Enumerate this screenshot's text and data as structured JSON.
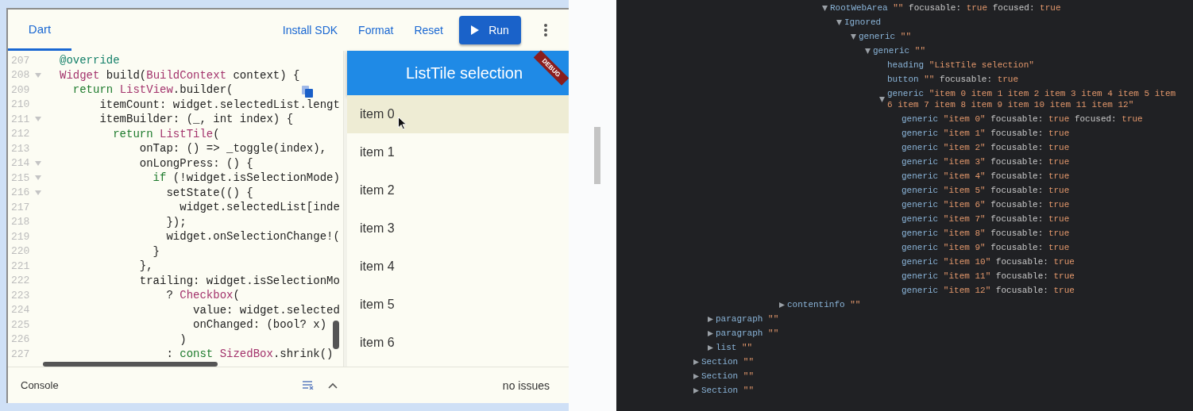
{
  "editor": {
    "tabs": [
      {
        "label": "Dart",
        "selected": true
      }
    ],
    "actions": [
      {
        "label": "Install SDK"
      },
      {
        "label": "Format"
      },
      {
        "label": "Reset"
      }
    ],
    "run_button": {
      "label": "Run"
    },
    "code": {
      "lines": [
        {
          "number": "207",
          "fold": false,
          "tokens": [
            {
              "kind": "annotation",
              "text": "@override"
            }
          ]
        },
        {
          "number": "208",
          "fold": true,
          "tokens": [
            {
              "kind": "type",
              "text": "Widget"
            },
            {
              "kind": "plain",
              "text": " build("
            },
            {
              "kind": "type",
              "text": "BuildContext"
            },
            {
              "kind": "plain",
              "text": " context) {"
            }
          ]
        },
        {
          "number": "209",
          "fold": false,
          "tokens": [
            {
              "kind": "keyword",
              "text": "  return "
            },
            {
              "kind": "type",
              "text": "ListView"
            },
            {
              "kind": "plain",
              "text": ".builder("
            }
          ]
        },
        {
          "number": "210",
          "fold": false,
          "tokens": [
            {
              "kind": "plain",
              "text": "      itemCount: widget.selectedList.lengt"
            }
          ]
        },
        {
          "number": "211",
          "fold": true,
          "tokens": [
            {
              "kind": "plain",
              "text": "      itemBuilder: (_, int index) {"
            }
          ]
        },
        {
          "number": "212",
          "fold": false,
          "tokens": [
            {
              "kind": "keyword",
              "text": "        return "
            },
            {
              "kind": "type",
              "text": "ListTile"
            },
            {
              "kind": "plain",
              "text": "("
            }
          ]
        },
        {
          "number": "213",
          "fold": false,
          "tokens": [
            {
              "kind": "plain",
              "text": "            onTap: () => _toggle(index),"
            }
          ]
        },
        {
          "number": "214",
          "fold": true,
          "tokens": [
            {
              "kind": "plain",
              "text": "            onLongPress: () {"
            }
          ]
        },
        {
          "number": "215",
          "fold": true,
          "tokens": [
            {
              "kind": "keyword",
              "text": "              if"
            },
            {
              "kind": "plain",
              "text": " (!widget.isSelectionMode)"
            }
          ]
        },
        {
          "number": "216",
          "fold": true,
          "tokens": [
            {
              "kind": "plain",
              "text": "                setState(() {"
            }
          ]
        },
        {
          "number": "217",
          "fold": false,
          "tokens": [
            {
              "kind": "plain",
              "text": "                  widget.selectedList[inde"
            }
          ]
        },
        {
          "number": "218",
          "fold": false,
          "tokens": [
            {
              "kind": "plain",
              "text": "                });"
            }
          ]
        },
        {
          "number": "219",
          "fold": false,
          "tokens": [
            {
              "kind": "plain",
              "text": "                widget.onSelectionChange!("
            }
          ]
        },
        {
          "number": "220",
          "fold": false,
          "tokens": [
            {
              "kind": "plain",
              "text": "              }"
            }
          ]
        },
        {
          "number": "221",
          "fold": false,
          "tokens": [
            {
              "kind": "plain",
              "text": "            },"
            }
          ]
        },
        {
          "number": "222",
          "fold": false,
          "tokens": [
            {
              "kind": "plain",
              "text": "            trailing: widget.isSelectionMo"
            }
          ]
        },
        {
          "number": "223",
          "fold": false,
          "tokens": [
            {
              "kind": "plain",
              "text": "                ? "
            },
            {
              "kind": "type",
              "text": "Checkbox"
            },
            {
              "kind": "plain",
              "text": "("
            }
          ]
        },
        {
          "number": "224",
          "fold": false,
          "tokens": [
            {
              "kind": "plain",
              "text": "                    value: widget.selected"
            }
          ]
        },
        {
          "number": "225",
          "fold": false,
          "tokens": [
            {
              "kind": "plain",
              "text": "                    onChanged: (bool? x)"
            }
          ]
        },
        {
          "number": "226",
          "fold": false,
          "tokens": [
            {
              "kind": "plain",
              "text": "                  )"
            }
          ]
        },
        {
          "number": "227",
          "fold": false,
          "tokens": [
            {
              "kind": "plain",
              "text": "                : "
            },
            {
              "kind": "keyword",
              "text": "const "
            },
            {
              "kind": "type",
              "text": "SizedBox"
            },
            {
              "kind": "plain",
              "text": ".shrink()"
            }
          ]
        }
      ]
    },
    "preview": {
      "title": "ListTile selection",
      "debug_banner": "DEBUG",
      "items": [
        {
          "label": "item 0",
          "selected": true
        },
        {
          "label": "item 1",
          "selected": false
        },
        {
          "label": "item 2",
          "selected": false
        },
        {
          "label": "item 3",
          "selected": false
        },
        {
          "label": "item 4",
          "selected": false
        },
        {
          "label": "item 5",
          "selected": false
        },
        {
          "label": "item 6",
          "selected": false
        }
      ]
    },
    "console": {
      "label": "Console"
    },
    "status": "no issues"
  },
  "accessibility_tree": [
    {
      "children": [
        {
          "children": [
            {
              "children": [
                {
                  "children": [
                    {
                      "children": [
                        {
                          "children": [
                            {
                              "children": [
                                {
                                  "children": [
                                    {
                                      "children": [
                                        {
                                          "role": "RootWebArea",
                                          "name": "\"\"",
                                          "props": [
                                            {
                                              "key": "focusable:",
                                              "value": "true"
                                            },
                                            {
                                              "key": "focused:",
                                              "value": "true"
                                            }
                                          ],
                                          "expanded": true,
                                          "children": [
                                            {
                                              "role": "Ignored",
                                              "expanded": true,
                                              "children": [
                                                {
                                                  "role": "generic",
                                                  "name": "\"\"",
                                                  "expanded": true,
                                                  "children": [
                                                    {
                                                      "role": "generic",
                                                      "name": "\"\"",
                                                      "expanded": true,
                                                      "children": [
                                                        {
                                                          "role": "heading",
                                                          "name": "\"ListTile selection\""
                                                        },
                                                        {
                                                          "role": "button",
                                                          "name": "\"\"",
                                                          "props": [
                                                            {
                                                              "key": "focusable:",
                                                              "value": "true"
                                                            }
                                                          ]
                                                        },
                                                        {
                                                          "role": "generic",
                                                          "name": "\"item 0 item 1 item 2 item 3 item 4 item 5 item 6 item 7 item 8 item 9 item 10 item 11 item 12\"",
                                                          "expanded": true,
                                                          "children": [
                                                            {
                                                              "role": "generic",
                                                              "name": "\"item 0\"",
                                                              "props": [
                                                                {
                                                                  "key": "focusable:",
                                                                  "value": "true"
                                                                },
                                                                {
                                                                  "key": "focused:",
                                                                  "value": "true"
                                                                }
                                                              ]
                                                            },
                                                            {
                                                              "role": "generic",
                                                              "name": "\"item 1\"",
                                                              "props": [
                                                                {
                                                                  "key": "focusable:",
                                                                  "value": "true"
                                                                }
                                                              ]
                                                            },
                                                            {
                                                              "role": "generic",
                                                              "name": "\"item 2\"",
                                                              "props": [
                                                                {
                                                                  "key": "focusable:",
                                                                  "value": "true"
                                                                }
                                                              ]
                                                            },
                                                            {
                                                              "role": "generic",
                                                              "name": "\"item 3\"",
                                                              "props": [
                                                                {
                                                                  "key": "focusable:",
                                                                  "value": "true"
                                                                }
                                                              ]
                                                            },
                                                            {
                                                              "role": "generic",
                                                              "name": "\"item 4\"",
                                                              "props": [
                                                                {
                                                                  "key": "focusable:",
                                                                  "value": "true"
                                                                }
                                                              ]
                                                            },
                                                            {
                                                              "role": "generic",
                                                              "name": "\"item 5\"",
                                                              "props": [
                                                                {
                                                                  "key": "focusable:",
                                                                  "value": "true"
                                                                }
                                                              ]
                                                            },
                                                            {
                                                              "role": "generic",
                                                              "name": "\"item 6\"",
                                                              "props": [
                                                                {
                                                                  "key": "focusable:",
                                                                  "value": "true"
                                                                }
                                                              ]
                                                            },
                                                            {
                                                              "role": "generic",
                                                              "name": "\"item 7\"",
                                                              "props": [
                                                                {
                                                                  "key": "focusable:",
                                                                  "value": "true"
                                                                }
                                                              ]
                                                            },
                                                            {
                                                              "role": "generic",
                                                              "name": "\"item 8\"",
                                                              "props": [
                                                                {
                                                                  "key": "focusable:",
                                                                  "value": "true"
                                                                }
                                                              ]
                                                            },
                                                            {
                                                              "role": "generic",
                                                              "name": "\"item 9\"",
                                                              "props": [
                                                                {
                                                                  "key": "focusable:",
                                                                  "value": "true"
                                                                }
                                                              ]
                                                            },
                                                            {
                                                              "role": "generic",
                                                              "name": "\"item 10\"",
                                                              "props": [
                                                                {
                                                                  "key": "focusable:",
                                                                  "value": "true"
                                                                }
                                                              ]
                                                            },
                                                            {
                                                              "role": "generic",
                                                              "name": "\"item 11\"",
                                                              "props": [
                                                                {
                                                                  "key": "focusable:",
                                                                  "value": "true"
                                                                }
                                                              ]
                                                            },
                                                            {
                                                              "role": "generic",
                                                              "name": "\"item 12\"",
                                                              "props": [
                                                                {
                                                                  "key": "focusable:",
                                                                  "value": "true"
                                                                }
                                                              ]
                                                            }
                                                          ]
                                                        }
                                                      ]
                                                    }
                                                  ]
                                                }
                                              ]
                                            }
                                          ]
                                        }
                                      ]
                                    }
                                  ]
                                }
                              ]
                            },
                            {
                              "role": "contentinfo",
                              "name": "\"\"",
                              "expanded": false
                            }
                          ]
                        }
                      ]
                    }
                  ]
                }
              ]
            }
          ]
        },
        {
          "role": "paragraph",
          "name": "\"\"",
          "expanded": false
        },
        {
          "role": "paragraph",
          "name": "\"\"",
          "expanded": false
        },
        {
          "role": "list",
          "name": "\"\"",
          "expanded": false
        }
      ]
    },
    {
      "role": "Section",
      "name": "\"\"",
      "expanded": false
    },
    {
      "role": "Section",
      "name": "\"\"",
      "expanded": false
    },
    {
      "role": "Section",
      "name": "\"\"",
      "expanded": false
    }
  ]
}
